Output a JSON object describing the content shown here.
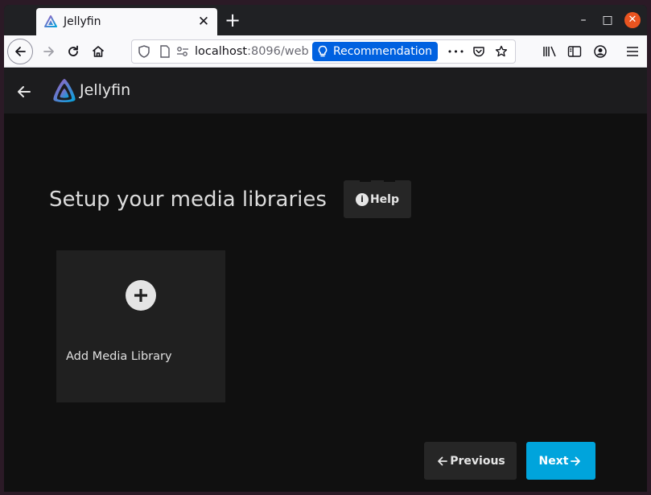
{
  "browser": {
    "tab_title": "Jellyfin",
    "url_host": "localhost",
    "url_rest": ":8096/web",
    "recommendation_label": "Recommendation",
    "more_label": "•••"
  },
  "app": {
    "name": "Jellyfin"
  },
  "main": {
    "title": "Setup your media libraries",
    "help_label": "Help",
    "add_library_label": "Add Media Library",
    "previous_label": "Previous",
    "next_label": "Next"
  },
  "colors": {
    "accent": "#00a4dc",
    "firefox_recommend": "#0061e0",
    "ubuntu_close": "#e95420"
  },
  "icons": {
    "back": "arrow-left-icon",
    "forward": "arrow-right-icon",
    "reload": "reload-icon",
    "home": "home-icon",
    "help_info": "info-icon",
    "add": "plus-icon"
  }
}
